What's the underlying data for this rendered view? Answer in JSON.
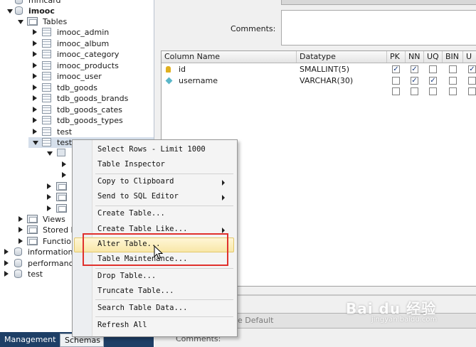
{
  "tree": {
    "top_partial": "mmcard",
    "schema": "imooc",
    "tables_folder": "Tables",
    "tables": [
      "imooc_admin",
      "imooc_album",
      "imooc_category",
      "imooc_products",
      "imooc_user",
      "tdb_goods",
      "tdb_goods_brands",
      "tdb_goods_cates",
      "tdb_goods_types",
      "test",
      "test2"
    ],
    "views": "Views",
    "stored": "Stored P",
    "functions": "Functio",
    "other_schemas": [
      "information",
      "performanc",
      "test"
    ]
  },
  "tabs": {
    "management": "Management",
    "schemas": "Schemas"
  },
  "editor": {
    "comments_label": "Comments:",
    "grid_headers": [
      "Column Name",
      "Datatype",
      "PK",
      "NN",
      "UQ",
      "BIN",
      "U"
    ],
    "rows": [
      {
        "name": "id",
        "datatype": "SMALLINT(5)",
        "pk": "✓",
        "nn": "✓",
        "uq": "",
        "bin": "",
        "u": "✓"
      },
      {
        "name": "username",
        "datatype": "VARCHAR(30)",
        "pk": "",
        "nn": "✓",
        "uq": "✓",
        "bin": "",
        "u": ""
      }
    ],
    "lower_text": "ble Default",
    "lower_comments": "Comments:"
  },
  "context_menu": {
    "items": [
      {
        "label": "Select Rows - Limit 1000",
        "submenu": false
      },
      {
        "label": "Table Inspector",
        "submenu": false
      },
      {
        "label": "Copy to Clipboard",
        "submenu": true
      },
      {
        "label": "Send to SQL Editor",
        "submenu": true
      },
      {
        "label": "Create Table...",
        "submenu": false
      },
      {
        "label": "Create Table Like...",
        "submenu": true
      },
      {
        "label": "Alter Table...",
        "submenu": false
      },
      {
        "label": "Table Maintenance...",
        "submenu": false
      },
      {
        "label": "Drop Table...",
        "submenu": false
      },
      {
        "label": "Truncate Table...",
        "submenu": false
      },
      {
        "label": "Search Table Data...",
        "submenu": false
      },
      {
        "label": "Refresh All",
        "submenu": false
      }
    ],
    "highlight_color": "#f8e7a8",
    "annotation_color": "#e0312d"
  },
  "watermark": {
    "main": "Bai du 经验",
    "sub": "jingyan.baidu.com"
  }
}
